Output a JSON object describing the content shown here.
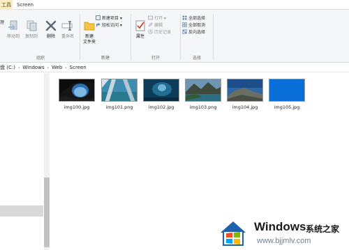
{
  "tabs": {
    "picture_tools": "工具",
    "screen": "Screen",
    "manage": "理"
  },
  "ribbon": {
    "organize": {
      "label": "组织",
      "move_to": "移动到",
      "copy_to": "复制到",
      "delete": "删除",
      "rename": "重命名"
    },
    "new": {
      "label": "新建",
      "new_folder_line1": "新建",
      "new_folder_line2": "文件夹",
      "new_item": "新建项目 ▾",
      "easy_access": "轻松访问 ▾"
    },
    "open": {
      "label": "打开",
      "properties": "属性",
      "open": "打开 ▾",
      "edit": "编辑",
      "history": "历史记录"
    },
    "select": {
      "label": "选择",
      "select_all": "全部选择",
      "select_none": "全部取消",
      "invert": "反向选择"
    }
  },
  "address": {
    "crumbs": [
      "盘 (C:)",
      "Windows",
      "Web",
      "Screen"
    ]
  },
  "files": [
    {
      "name": "img100.jpg"
    },
    {
      "name": "img101.png"
    },
    {
      "name": "img102.jpg"
    },
    {
      "name": "img103.png"
    },
    {
      "name": "img104.jpg"
    },
    {
      "name": "img105.jpg"
    }
  ],
  "watermark": {
    "title": "Windows",
    "subtitle": "系统之家",
    "url": "www.bjjmlv.com"
  }
}
